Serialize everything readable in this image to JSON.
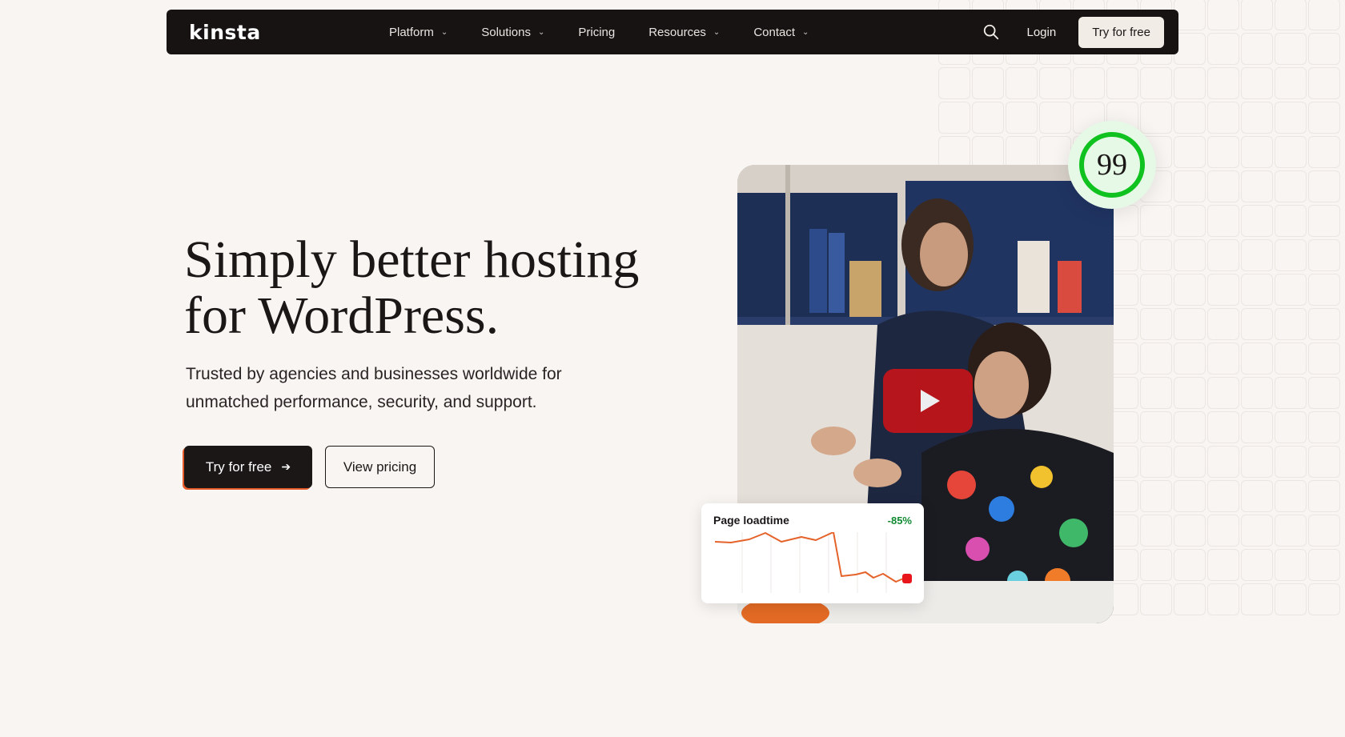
{
  "nav": {
    "logo": "kinsta",
    "items": [
      {
        "label": "Platform",
        "has_dropdown": true
      },
      {
        "label": "Solutions",
        "has_dropdown": true
      },
      {
        "label": "Pricing",
        "has_dropdown": false
      },
      {
        "label": "Resources",
        "has_dropdown": true
      },
      {
        "label": "Contact",
        "has_dropdown": true
      }
    ],
    "search_icon": "search-icon",
    "login_label": "Login",
    "cta_label": "Try for free"
  },
  "hero": {
    "title_line1": "Simply better hosting",
    "title_line2": "for WordPress.",
    "subtitle_line1": "Trusted by agencies and businesses worldwide for",
    "subtitle_line2": "unmatched performance, security, and support.",
    "primary_button": "Try for free",
    "primary_button_icon": "arrow-right-icon",
    "secondary_button": "View pricing"
  },
  "media": {
    "play_icon": "play-icon",
    "score": "99",
    "loadtime_title": "Page loadtime",
    "loadtime_change": "-85%"
  },
  "colors": {
    "background": "#f8f5f2",
    "nav_bg": "#171313",
    "accent_orange": "#e55b2a",
    "score_green": "#10c21f",
    "change_green": "#118a32",
    "play_red": "#c4141a"
  }
}
